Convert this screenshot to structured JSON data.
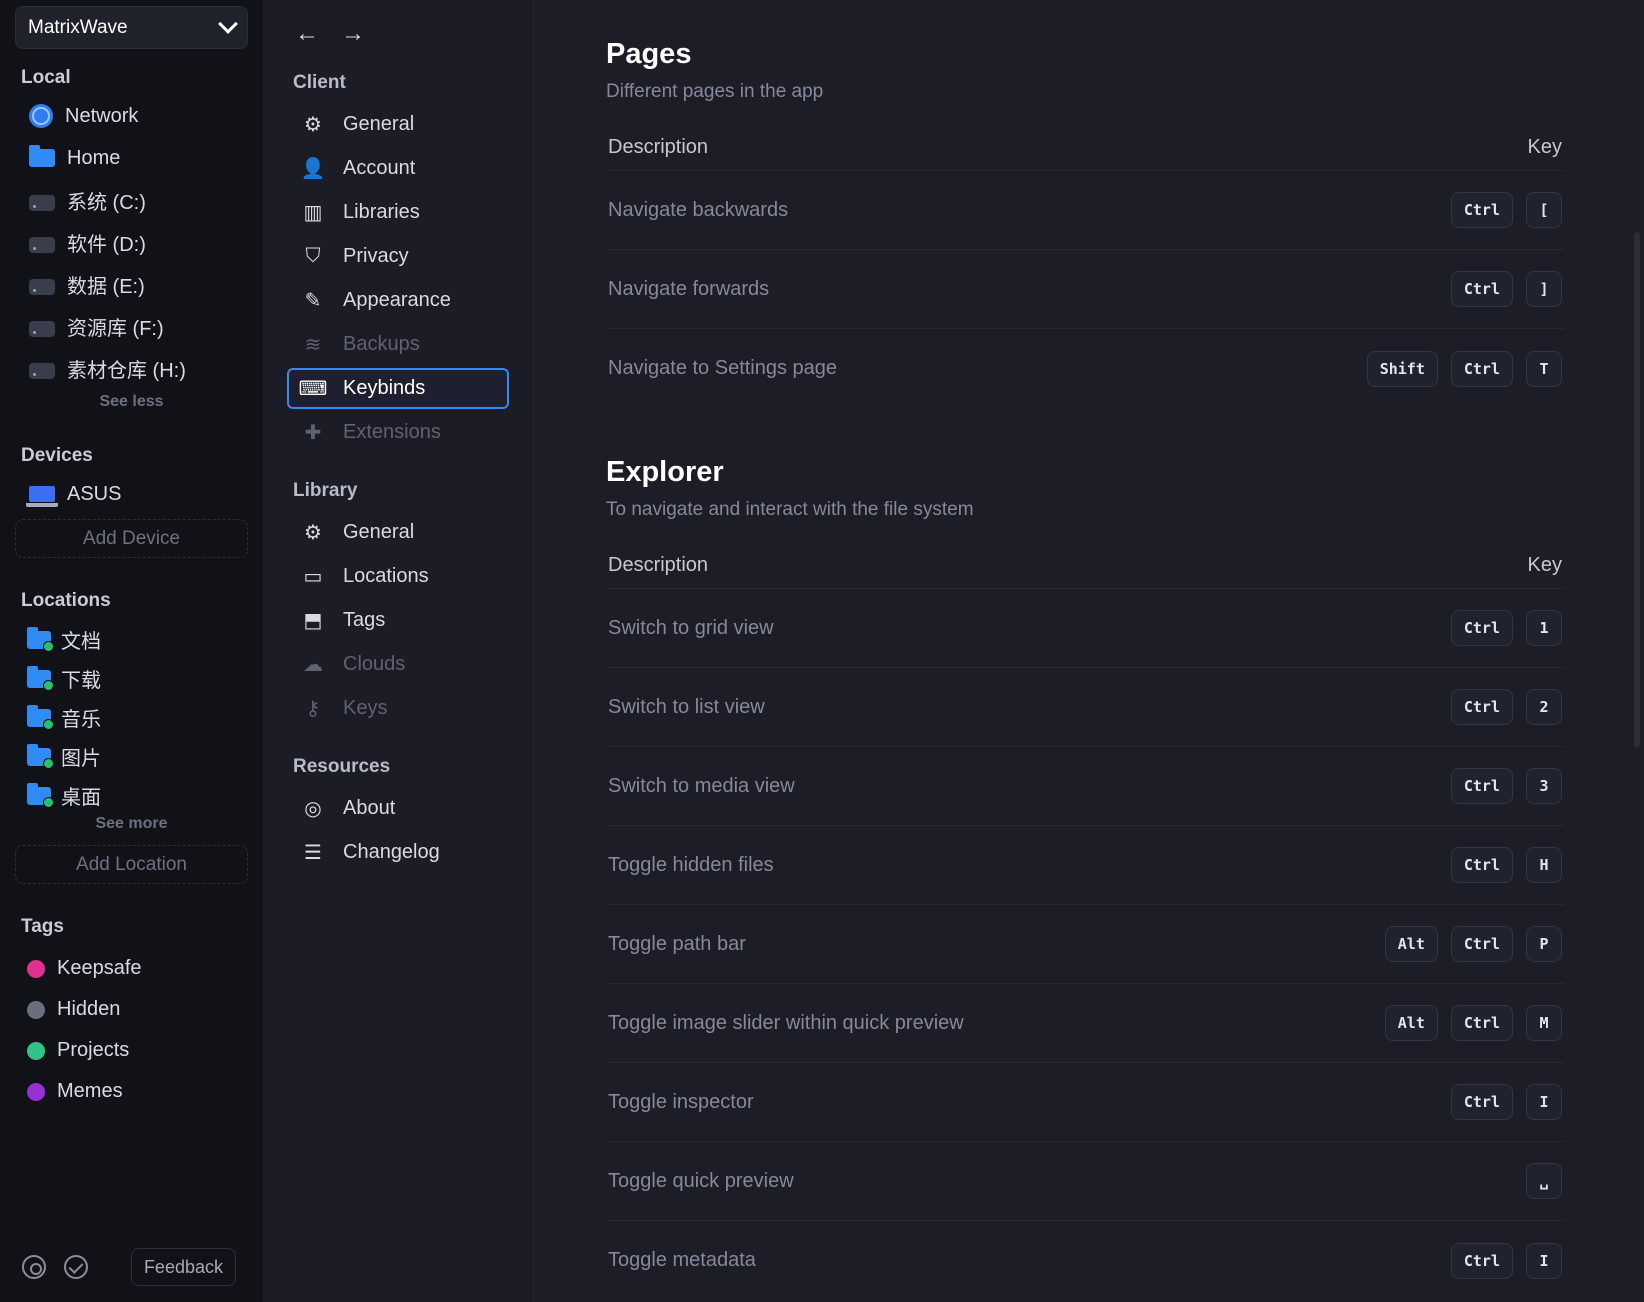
{
  "sidebar": {
    "library_name": "MatrixWave",
    "local_title": "Local",
    "local_items": [
      {
        "label": "Network",
        "icon": "globe-icon"
      },
      {
        "label": "Home",
        "icon": "home-folder-icon"
      },
      {
        "label": "系统 (C:)",
        "icon": "drive-icon"
      },
      {
        "label": "软件 (D:)",
        "icon": "drive-icon"
      },
      {
        "label": "数据 (E:)",
        "icon": "drive-icon"
      },
      {
        "label": "资源库 (F:)",
        "icon": "drive-icon"
      },
      {
        "label": "素材仓库 (H:)",
        "icon": "drive-icon"
      }
    ],
    "see_less": "See less",
    "devices_title": "Devices",
    "device": "ASUS",
    "add_device": "Add Device",
    "locations_title": "Locations",
    "locations": [
      "文档",
      "下载",
      "音乐",
      "图片",
      "桌面"
    ],
    "see_more": "See more",
    "add_location": "Add Location",
    "tags_title": "Tags",
    "tags": [
      {
        "label": "Keepsafe",
        "color": "#e3308e"
      },
      {
        "label": "Hidden",
        "color": "#6b6e80"
      },
      {
        "label": "Projects",
        "color": "#2fc486"
      },
      {
        "label": "Memes",
        "color": "#9b2fd6"
      }
    ],
    "feedback": "Feedback"
  },
  "settings_nav": {
    "client_title": "Client",
    "client_items": [
      "General",
      "Account",
      "Libraries",
      "Privacy",
      "Appearance",
      "Backups",
      "Keybinds",
      "Extensions"
    ],
    "library_title": "Library",
    "library_items": [
      "General",
      "Locations",
      "Tags",
      "Clouds",
      "Keys"
    ],
    "resources_title": "Resources",
    "resources_items": [
      "About",
      "Changelog"
    ],
    "active": "Keybinds"
  },
  "pages": {
    "title": "Pages",
    "subtitle": "Different pages in the app",
    "col_desc": "Description",
    "col_key": "Key",
    "rows": [
      {
        "desc": "Navigate backwards",
        "keys": [
          "Ctrl",
          "["
        ]
      },
      {
        "desc": "Navigate forwards",
        "keys": [
          "Ctrl",
          "]"
        ]
      },
      {
        "desc": "Navigate to Settings page",
        "keys": [
          "Shift",
          "Ctrl",
          "T"
        ]
      }
    ]
  },
  "explorer": {
    "title": "Explorer",
    "subtitle": "To navigate and interact with the file system",
    "col_desc": "Description",
    "col_key": "Key",
    "rows": [
      {
        "desc": "Switch to grid view",
        "keys": [
          "Ctrl",
          "1"
        ]
      },
      {
        "desc": "Switch to list view",
        "keys": [
          "Ctrl",
          "2"
        ]
      },
      {
        "desc": "Switch to media view",
        "keys": [
          "Ctrl",
          "3"
        ]
      },
      {
        "desc": "Toggle hidden files",
        "keys": [
          "Ctrl",
          "H"
        ]
      },
      {
        "desc": "Toggle path bar",
        "keys": [
          "Alt",
          "Ctrl",
          "P"
        ]
      },
      {
        "desc": "Toggle image slider within quick preview",
        "keys": [
          "Alt",
          "Ctrl",
          "M"
        ]
      },
      {
        "desc": "Toggle inspector",
        "keys": [
          "Ctrl",
          "I"
        ]
      },
      {
        "desc": "Toggle quick preview",
        "keys": [
          "␣"
        ]
      },
      {
        "desc": "Toggle metadata",
        "keys": [
          "Ctrl",
          "I"
        ]
      }
    ]
  }
}
